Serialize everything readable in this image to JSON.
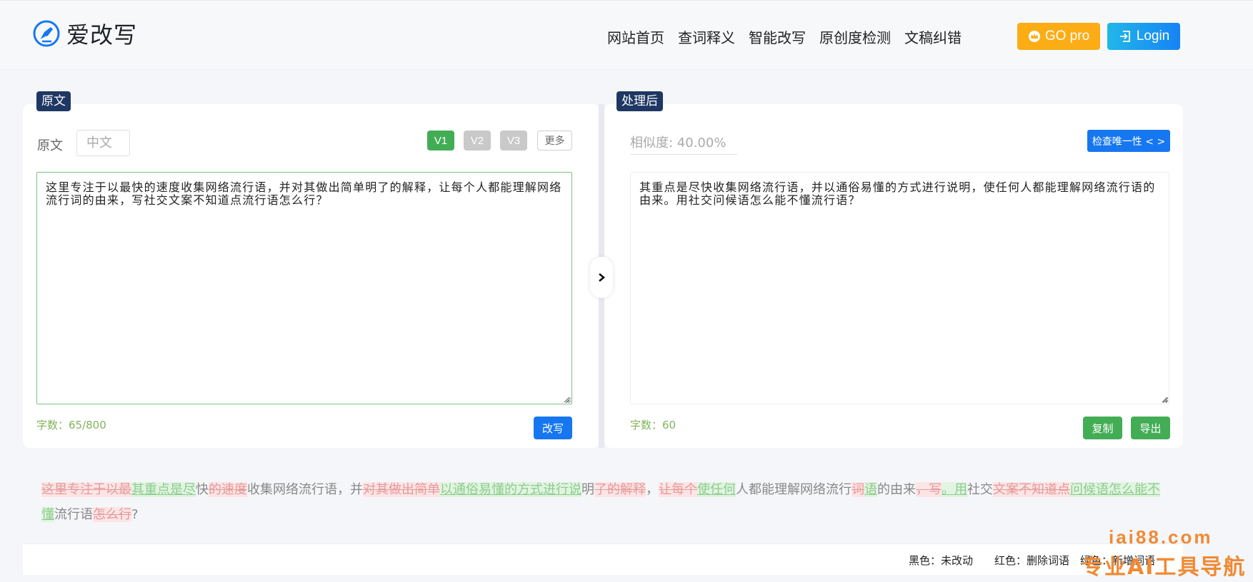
{
  "header": {
    "logo_text": "爱改写",
    "nav": [
      "网站首页",
      "查词释义",
      "智能改写",
      "原创度检测",
      "文稿纠错"
    ],
    "pro_label": "GO pro",
    "login_label": "Login"
  },
  "left": {
    "tag": "原文",
    "lang_label": "原文",
    "lang_select": "中文",
    "versions": [
      "V1",
      "V2",
      "V3"
    ],
    "more": "更多",
    "text": "这里专注于以最快的速度收集网络流行语，并对其做出简单明了的解释，让每个人都能理解网络流行词的由来，写社交文案不知道点流行语怎么行？",
    "count": "字数：65/800",
    "rewrite": "改写"
  },
  "right": {
    "tag": "处理后",
    "similarity": "相似度: 40.00%",
    "check": "检查唯一性 < >",
    "text": "其重点是尽快收集网络流行语，并以通俗易懂的方式进行说明，使任何人都能理解网络流行语的由来。用社交问候语怎么能不懂流行语？",
    "count": "字数：60",
    "copy": "复制",
    "export": "导出"
  },
  "diff": [
    {
      "t": "这里专注于以最",
      "s": "del"
    },
    {
      "t": "其重点是尽",
      "s": "add"
    },
    {
      "t": "快",
      "s": "same"
    },
    {
      "t": "的速度",
      "s": "del"
    },
    {
      "t": "收集网络流行语，并",
      "s": "same"
    },
    {
      "t": "对其做出简单",
      "s": "del"
    },
    {
      "t": "以通俗易懂的方式进行说",
      "s": "add"
    },
    {
      "t": "明",
      "s": "same"
    },
    {
      "t": "了的解释",
      "s": "del"
    },
    {
      "t": "，",
      "s": "same"
    },
    {
      "t": "让每个",
      "s": "del"
    },
    {
      "t": "使任何",
      "s": "add"
    },
    {
      "t": "人都能理解网络流行",
      "s": "same"
    },
    {
      "t": "词",
      "s": "del"
    },
    {
      "t": "语",
      "s": "add"
    },
    {
      "t": "的由来",
      "s": "same"
    },
    {
      "t": "，写",
      "s": "del"
    },
    {
      "t": "。用",
      "s": "add"
    },
    {
      "t": "社交",
      "s": "same"
    },
    {
      "t": "文案不知道点",
      "s": "del"
    },
    {
      "t": "问候语怎么能不懂",
      "s": "add"
    },
    {
      "t": "流行语",
      "s": "same"
    },
    {
      "t": "怎么行",
      "s": "del"
    },
    {
      "t": "?",
      "s": "same"
    }
  ],
  "legend": {
    "black": "黑色：未改动",
    "red": "红色：删除词语",
    "green": "绿色：新增词语"
  },
  "watermark": {
    "line1": "iai88.com",
    "line2": "专业AI工具导航"
  },
  "colors": {
    "accent_blue": "#1677f0",
    "green": "#43ad55",
    "pro_orange": "#fcad16",
    "tag_navy": "#1f3763"
  }
}
